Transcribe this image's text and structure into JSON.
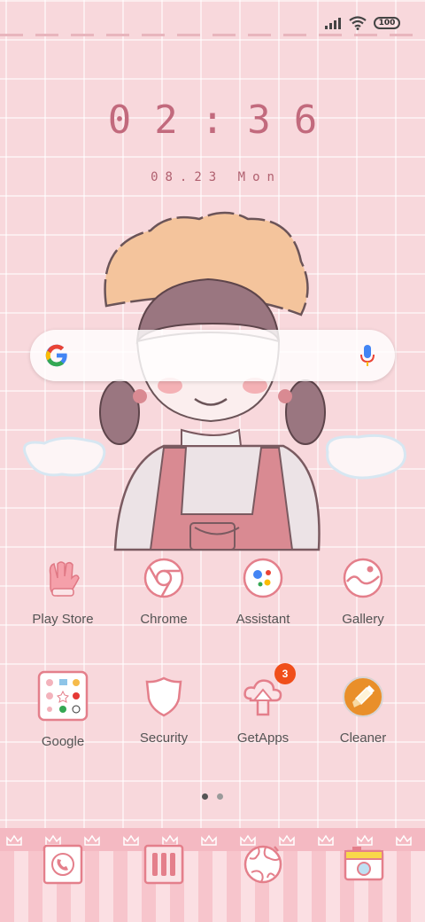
{
  "status_bar": {
    "battery_level": "100",
    "signal_icon": "signal-icon",
    "wifi_icon": "wifi-icon"
  },
  "clock": {
    "time": "02:36",
    "date": "08.23 Mon"
  },
  "search": {
    "google_icon": "google-g-icon",
    "mic_icon": "mic-icon"
  },
  "apps_row1": [
    {
      "label": "Play Store",
      "icon": "glove-icon"
    },
    {
      "label": "Chrome",
      "icon": "chrome-icon"
    },
    {
      "label": "Assistant",
      "icon": "assistant-icon"
    },
    {
      "label": "Gallery",
      "icon": "gallery-icon"
    }
  ],
  "apps_row2": [
    {
      "label": "Google",
      "icon": "folder-icon"
    },
    {
      "label": "Security",
      "icon": "shield-icon"
    },
    {
      "label": "GetApps",
      "icon": "cloud-upload-icon",
      "badge": "3"
    },
    {
      "label": "Cleaner",
      "icon": "brush-icon"
    }
  ],
  "page_indicator": {
    "count": 2,
    "active": 1
  },
  "dock": [
    {
      "icon": "phone-icon"
    },
    {
      "icon": "apps-drawer-icon"
    },
    {
      "icon": "globe-icon"
    },
    {
      "icon": "camera-icon"
    }
  ],
  "colors": {
    "accent": "#c26a7d",
    "background": "#f8d8dc",
    "badge": "#f04e1a"
  }
}
